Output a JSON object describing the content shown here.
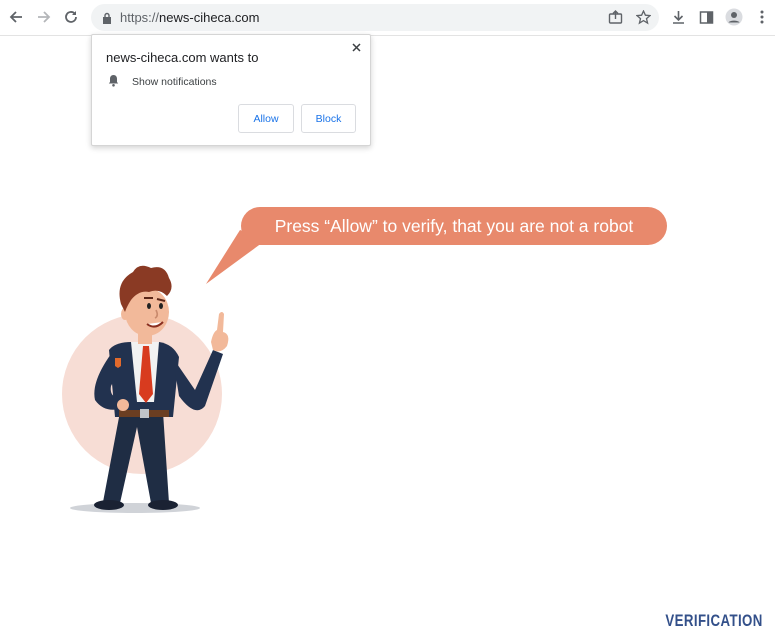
{
  "browser": {
    "url_protocol": "https://",
    "url_host": "news-ciheca.com"
  },
  "notification_prompt": {
    "title": "news-ciheca.com wants to",
    "permission": "Show notifications",
    "allow_label": "Allow",
    "block_label": "Block"
  },
  "page": {
    "speech_bubble": "Press “Allow” to verify, that you are not a robot",
    "watermark": "VERIFICATION",
    "bubble_color": "#e8896c"
  },
  "icons": [
    "back-icon",
    "forward-icon",
    "reload-icon",
    "lock-icon",
    "share-icon",
    "star-icon",
    "download-icon",
    "side-panel-icon",
    "profile-icon",
    "menu-icon",
    "close-icon",
    "bell-icon"
  ]
}
